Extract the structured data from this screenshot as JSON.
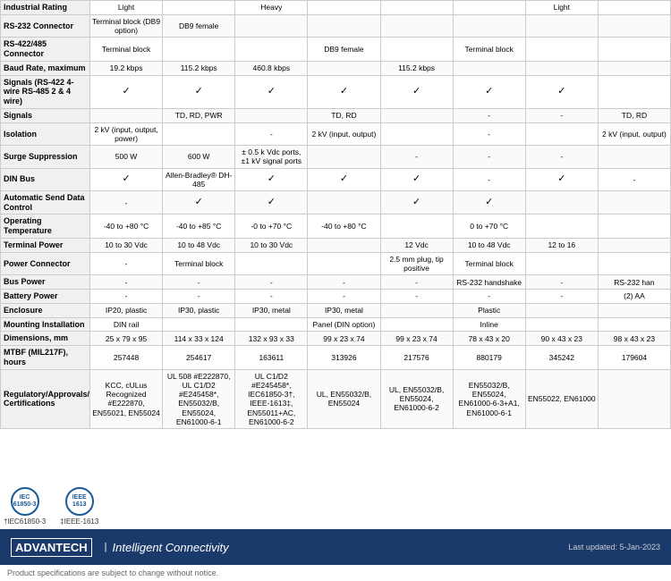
{
  "table": {
    "rows": [
      {
        "label": "Industrial Rating",
        "cols": [
          "Light",
          "",
          "Heavy",
          "",
          "",
          "",
          "Light",
          ""
        ]
      },
      {
        "label": "RS-232 Connector",
        "cols": [
          "Terminal block (DB9 option)",
          "DB9 female",
          "",
          "",
          "",
          "",
          "",
          ""
        ]
      },
      {
        "label": "RS-422/485 Connector",
        "cols": [
          "Terminal block",
          "",
          "",
          "DB9 female",
          "",
          "Terminal block",
          "",
          ""
        ]
      },
      {
        "label": "Baud Rate, maximum",
        "cols": [
          "19.2 kbps",
          "115.2 kbps",
          "460.8 kbps",
          "",
          "115.2 kbps",
          "",
          "",
          ""
        ]
      },
      {
        "label": "Signals (RS-422 4-wire RS-485 2 & 4 wire)",
        "cols": [
          "✓",
          "✓",
          "✓",
          "✓",
          "✓",
          "✓",
          "✓",
          ""
        ]
      },
      {
        "label": "Signals",
        "cols": [
          "",
          "TD, RD, PWR",
          "",
          "TD, RD",
          "",
          "-",
          "-",
          "TD, RD"
        ]
      },
      {
        "label": "Isolation",
        "cols": [
          "2 kV (input, output, power)",
          "",
          "-",
          "2 kV (input, output)",
          "",
          "-",
          "",
          "2 kV (input, output)"
        ]
      },
      {
        "label": "Surge Suppression",
        "cols": [
          "500 W",
          "600 W",
          "± 0.5 k Vdc ports, ±1 kV signal ports",
          "",
          "-",
          "-",
          "-",
          ""
        ]
      },
      {
        "label": "DIN Bus",
        "cols": [
          "✓",
          "Allen-Bradley® DH-485",
          "✓",
          "✓",
          "✓",
          "-",
          "✓",
          "-"
        ]
      },
      {
        "label": "Automatic Send Data Control",
        "cols": [
          "-",
          "✓",
          "✓",
          "",
          "✓",
          "✓",
          "",
          ""
        ]
      },
      {
        "label": "Operating Temperature",
        "cols": [
          "-40 to +80 °C",
          "-40 to +85 °C",
          "-0 to +70 °C",
          "-40 to +80 °C",
          "",
          "0 to +70 °C",
          "",
          ""
        ]
      },
      {
        "label": "Terminal Power",
        "cols": [
          "10 to 30 Vdc",
          "10 to 48 Vdc",
          "10 to 30 Vdc",
          "",
          "12 Vdc",
          "10 to 48 Vdc",
          "12 to 16",
          ""
        ]
      },
      {
        "label": "Power Connector",
        "cols": [
          "-",
          "Terminal block",
          "",
          "",
          "2.5 mm plug, tip positive",
          "Terminal block",
          "",
          ""
        ]
      },
      {
        "label": "Bus Power",
        "cols": [
          "-",
          "-",
          "-",
          "-",
          "-",
          "RS-232 handshake",
          "-",
          "RS-232 han"
        ]
      },
      {
        "label": "Battery Power",
        "cols": [
          "-",
          "-",
          "-",
          "-",
          "-",
          "-",
          "-",
          "(2) AA"
        ]
      },
      {
        "label": "Enclosure",
        "cols": [
          "IP20, plastic",
          "IP30, plastic",
          "IP30, metal",
          "IP30, metal",
          "",
          "Plastic",
          "",
          ""
        ]
      },
      {
        "label": "Mounting Installation",
        "cols": [
          "DIN rail",
          "",
          "",
          "Panel (DIN option)",
          "",
          "Inline",
          "",
          ""
        ]
      },
      {
        "label": "Dimensions, mm",
        "cols": [
          "25 x 79 x 95",
          "114 x 33 x 124",
          "132 x 93 x 33",
          "99 x 23 x 74",
          "99 x 23 x 74",
          "78 x 43 x 20",
          "90 x 43 x 23",
          "98 x 43 x 23"
        ]
      },
      {
        "label": "MTBF (MIL217F), hours",
        "cols": [
          "257448",
          "254617",
          "163611",
          "313926",
          "217576",
          "880179",
          "345242",
          "179604"
        ]
      },
      {
        "label": "Regulatory/Approvals/ Certifications",
        "cols": [
          "KCC, cULus Recognized #E222870, EN55021, EN55024",
          "UL 508 #E222870, UL C1/D2 #E245458*, EN55032/B, EN55024, EN61000-6-1",
          "UL C1/D2 #E245458*, IEC61850-3†, IEEE-1613‡, EN55011+AC, EN61000-6-2",
          "UL, EN55032/B, EN55024",
          "UL, EN55032/B, EN55024, EN61000-6-2",
          "EN55032/B, EN55024, EN61000-6-3+A1, EN61000-6-1",
          "EN55022, EN61000",
          ""
        ]
      }
    ]
  },
  "certifications": [
    {
      "badge": "IEC\n61850-3",
      "label": "†IEC61850-3"
    },
    {
      "badge": "IEEE\n1613",
      "label": "‡IEEE-1613"
    }
  ],
  "footer": {
    "logo": "ADVANTECH",
    "tagline": "Intelligent Connectivity",
    "disclaimer": "Product specifications are subject to change without notice.",
    "last_updated": "Last updated: 5-Jan-2023"
  }
}
